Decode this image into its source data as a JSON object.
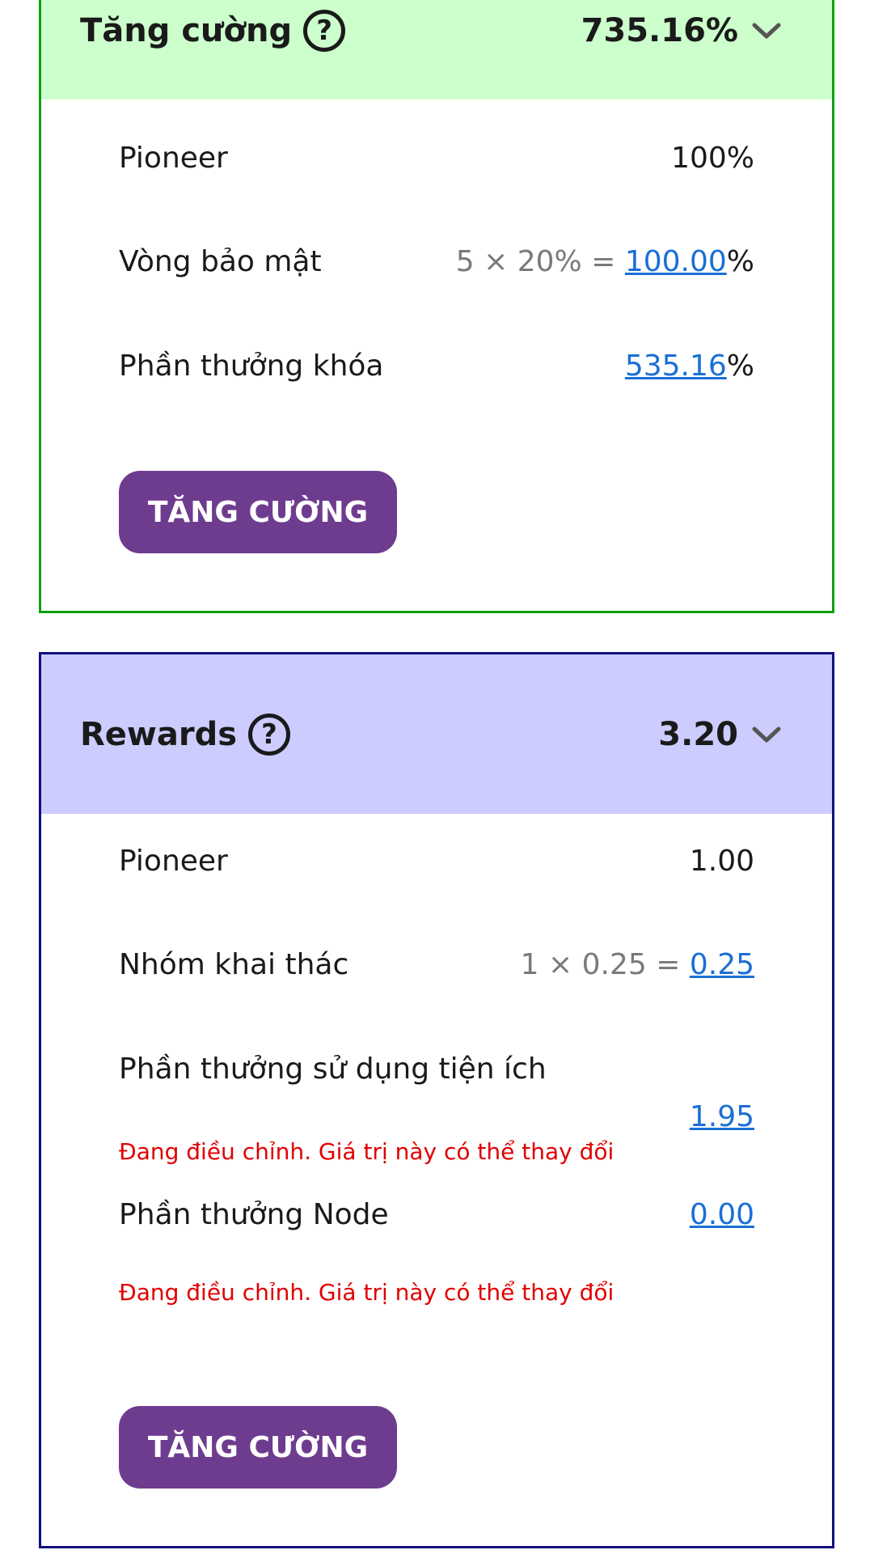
{
  "boost_card": {
    "title": "Tăng cường",
    "total": "735.16%",
    "accent_color": "#0ea00e",
    "header_color": "#ccffcc",
    "rows": [
      {
        "label": "Pioneer",
        "value": "100%"
      },
      {
        "label": "Vòng bảo mật",
        "formula": "5 × 20% = ",
        "link": "100.00",
        "suffix": "%"
      },
      {
        "label": "Phần thưởng khóa",
        "link": "535.16",
        "suffix": "%"
      }
    ],
    "button_label": "TĂNG CƯỜNG"
  },
  "rewards_card": {
    "title": "Rewards",
    "total": "3.20",
    "accent_color": "#10107e",
    "header_color": "#ccccff",
    "rows": [
      {
        "label": "Pioneer",
        "value": "1.00"
      },
      {
        "label": "Nhóm khai thác",
        "formula": "1 × 0.25 = ",
        "link": "0.25"
      },
      {
        "label": "Phần thưởng sử dụng tiện ích",
        "link": "1.95",
        "warning": "Đang điều chỉnh. Giá trị này có thể thay đổi"
      },
      {
        "label": "Phần thưởng Node",
        "link": "0.00",
        "warning": "Đang điều chỉnh. Giá trị này có thể thay đổi"
      }
    ],
    "button_label": "TĂNG CƯỜNG"
  },
  "icons": {
    "help": "help-circle-icon",
    "chevron": "chevron-down-icon"
  },
  "button_color": "#6e3c8f",
  "link_color": "#1a6fd6",
  "warning_color": "#e00000"
}
